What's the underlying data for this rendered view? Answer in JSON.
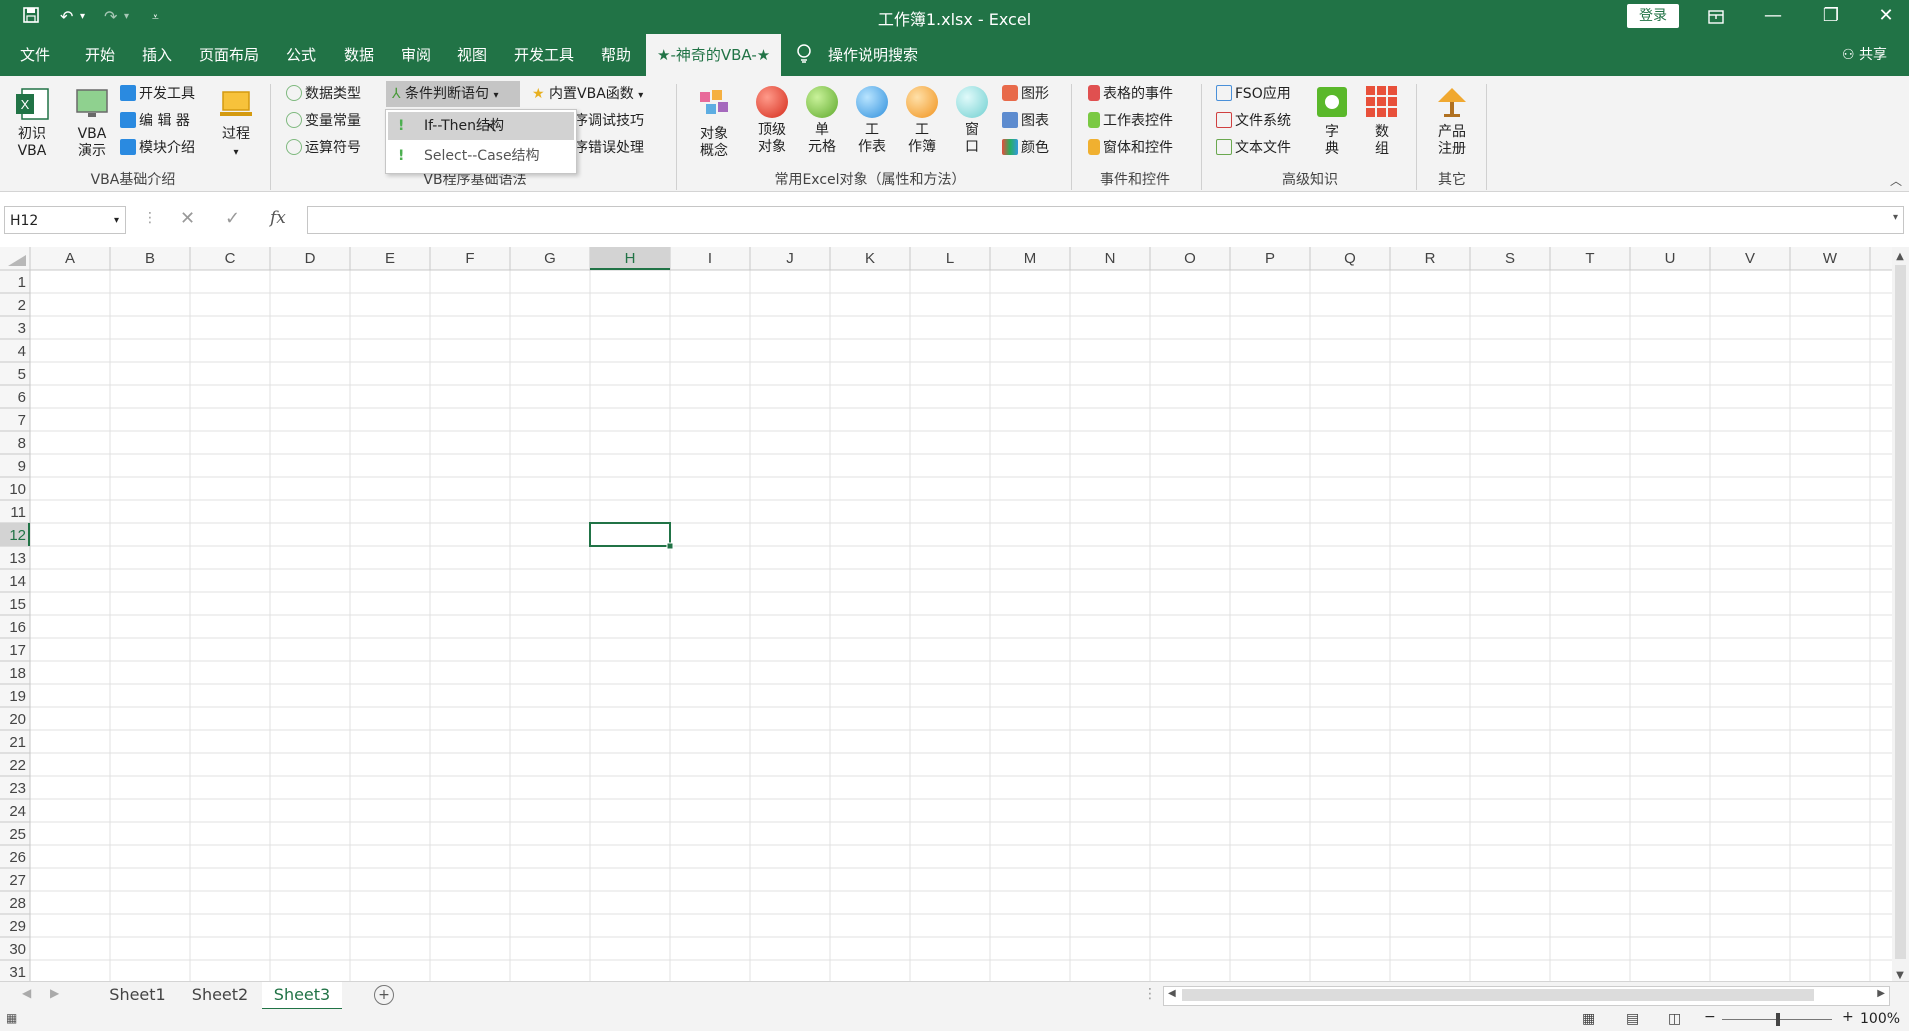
{
  "window": {
    "title": "工作簿1.xlsx  -  Excel",
    "login": "登录"
  },
  "menu": [
    "文件",
    "开始",
    "插入",
    "页面布局",
    "公式",
    "数据",
    "审阅",
    "视图",
    "开发工具",
    "帮助"
  ],
  "menu_active": "★-神奇的VBA-★",
  "tell_me": "操作说明搜索",
  "share": "共享",
  "ribbon": {
    "vba_intro": {
      "label": "VBA基础介绍",
      "big_first": "初识\nVBA",
      "big_demo": "VBA\n演示",
      "small": [
        "开发工具",
        "编 辑 器",
        "模块介绍"
      ],
      "process": "过程"
    },
    "vb_syntax": {
      "label": "VB程序基础语法",
      "col1": [
        "数据类型",
        "变量常量",
        "运算符号"
      ],
      "cond": "条件判断语句",
      "col3": [
        "内置VBA函数",
        "序调试技巧",
        "序错误处理"
      ]
    },
    "excel_objects": {
      "label": "常用Excel对象（属性和方法）",
      "concept": "对象\n概念",
      "balls": [
        "顶级\n对象",
        "单\n元格",
        "工\n作表",
        "工\n作簿",
        "窗\n口"
      ],
      "small": [
        "图形",
        "图表",
        "颜色"
      ]
    },
    "events": {
      "label": "事件和控件",
      "items": [
        "表格的事件",
        "工作表控件",
        "窗体和控件"
      ]
    },
    "advanced": {
      "label": "高级知识",
      "items": [
        "FSO应用",
        "文件系统",
        "文本文件"
      ],
      "dict": "字\n典",
      "array": "数\n组"
    },
    "other": {
      "label": "其它",
      "register": "产品\n注册"
    }
  },
  "dropdown": {
    "items": [
      "If--Then结构",
      "Select--Case结构"
    ]
  },
  "namebox": "H12",
  "columns": [
    "A",
    "B",
    "C",
    "D",
    "E",
    "F",
    "G",
    "H",
    "I",
    "J",
    "K",
    "L",
    "M",
    "N",
    "O",
    "P",
    "Q",
    "R",
    "S",
    "T",
    "U",
    "V",
    "W"
  ],
  "rows": [
    "1",
    "2",
    "3",
    "4",
    "5",
    "6",
    "7",
    "8",
    "9",
    "10",
    "11",
    "12",
    "13",
    "14",
    "15",
    "16",
    "17",
    "18",
    "19",
    "20",
    "21",
    "22",
    "23",
    "24",
    "25",
    "26",
    "27",
    "28",
    "29",
    "30",
    "31"
  ],
  "selected_cell": "H12",
  "sheets": [
    "Sheet1",
    "Sheet2",
    "Sheet3"
  ],
  "active_sheet": "Sheet3",
  "zoom": "100%",
  "colors": {
    "excel_green": "#217346",
    "ribbon_bg": "#f3f3f3"
  }
}
